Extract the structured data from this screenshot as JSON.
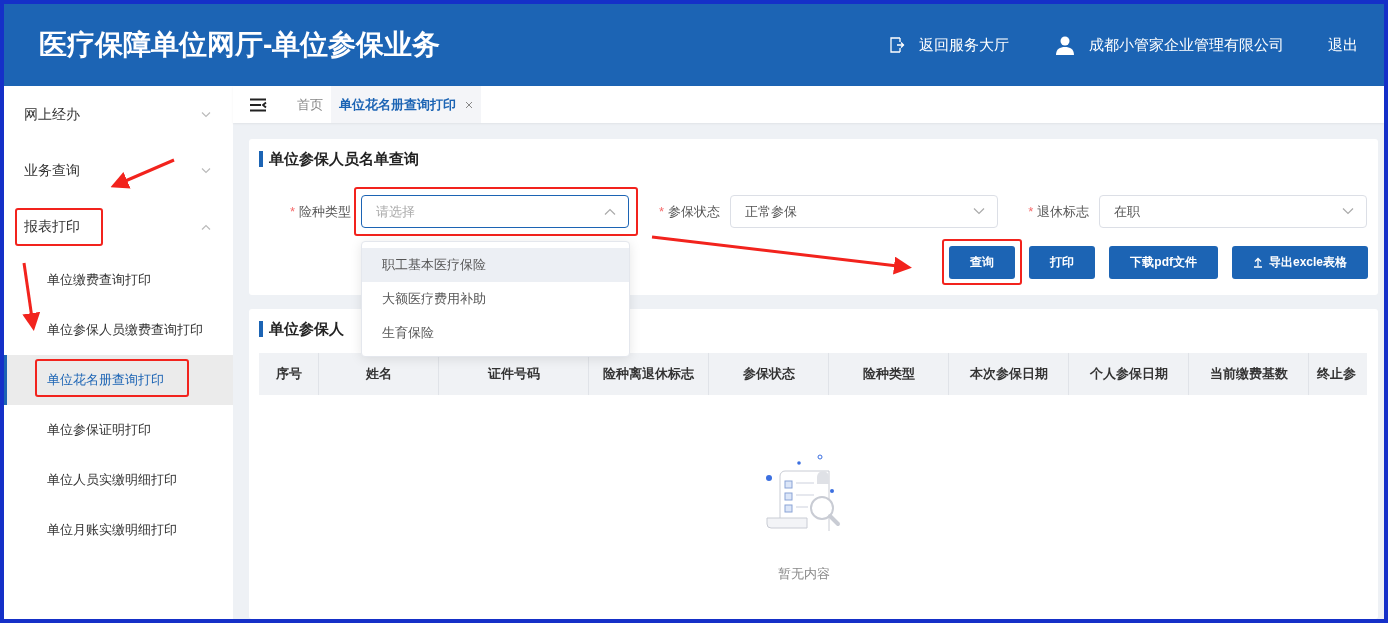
{
  "header": {
    "title": "医疗保障单位网厅-单位参保业务",
    "back_link": "返回服务大厅",
    "company": "成都小管家企业管理有限公司",
    "logout": "退出"
  },
  "sidebar": {
    "groups": [
      {
        "label": "网上经办",
        "expanded": false,
        "highlighted": false
      },
      {
        "label": "业务查询",
        "expanded": false,
        "highlighted": false
      },
      {
        "label": "报表打印",
        "expanded": true,
        "highlighted": true,
        "children": [
          {
            "label": "单位缴费查询打印",
            "selected": false,
            "highlighted": false
          },
          {
            "label": "单位参保人员缴费查询打印",
            "selected": false,
            "highlighted": false
          },
          {
            "label": "单位花名册查询打印",
            "selected": true,
            "highlighted": true
          },
          {
            "label": "单位参保证明打印",
            "selected": false,
            "highlighted": false
          },
          {
            "label": "单位人员实缴明细打印",
            "selected": false,
            "highlighted": false
          },
          {
            "label": "单位月账实缴明细打印",
            "selected": false,
            "highlighted": false
          }
        ]
      }
    ]
  },
  "tabs": [
    {
      "label": "首页",
      "selected": false,
      "closable": false
    },
    {
      "label": "单位花名册查询打印",
      "selected": true,
      "closable": true
    }
  ],
  "search_card": {
    "title": "单位参保人员名单查询",
    "fields": [
      {
        "mark": "*",
        "label": "险种类型",
        "placeholder": "请选择",
        "open": true,
        "highlighted": true
      },
      {
        "mark": "*",
        "label": "参保状态",
        "value": "正常参保",
        "open": false,
        "highlighted": false
      },
      {
        "mark": "*",
        "label": "退休标志",
        "value": "在职",
        "open": false,
        "highlighted": false
      }
    ],
    "dropdown_options": [
      {
        "label": "职工基本医疗保险",
        "hovered": true
      },
      {
        "label": "大额医疗费用补助",
        "hovered": false
      },
      {
        "label": "生育保险",
        "hovered": false
      }
    ],
    "buttons": [
      {
        "label": "查询",
        "highlighted": true
      },
      {
        "label": "打印",
        "highlighted": false
      },
      {
        "label": "下载pdf文件",
        "highlighted": false
      },
      {
        "label": "导出excle表格",
        "highlighted": false
      }
    ]
  },
  "table_card": {
    "title": "单位参保人",
    "columns": [
      "序号",
      "姓名",
      "证件号码",
      "险种离退休标志",
      "参保状态",
      "险种类型",
      "本次参保日期",
      "个人参保日期",
      "当前缴费基数",
      "终止参"
    ],
    "empty_text": "暂无内容"
  }
}
